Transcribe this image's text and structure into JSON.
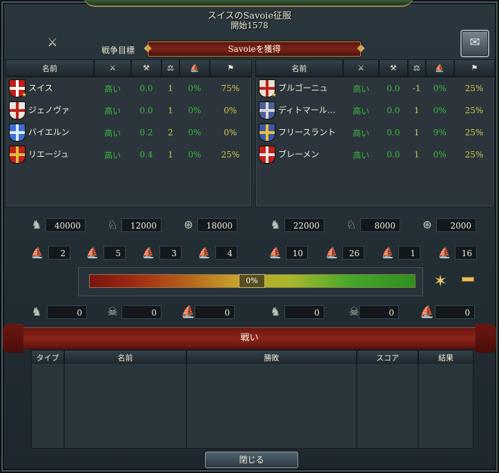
{
  "window": {
    "title": "スイスのSavoie征服",
    "subtitle": "開始1578"
  },
  "wargoal": {
    "label": "戦争目標",
    "value": "Savoieを獲得"
  },
  "columns": {
    "name": "名前",
    "icons": [
      "crossed-swords-icon",
      "crossed-axes-icon",
      "scales-icon",
      "ship-icon",
      "soldier-icon"
    ],
    "icon_glyphs": [
      "⚔",
      "⚒",
      "⚖",
      "⛵",
      "⚑"
    ]
  },
  "attackers": [
    {
      "name": "スイス",
      "enthusiasm": "高い",
      "v1": "0.0",
      "v2": "1",
      "v3": "0%",
      "v4": "75%",
      "flag_color": "#c0201a",
      "flag_cross": "#ffffff",
      "leader": true
    },
    {
      "name": "ジェノヴァ",
      "enthusiasm": "高い",
      "v1": "0.0",
      "v2": "1",
      "v3": "0%",
      "v4": "0%",
      "flag_color": "#e9e6e0",
      "flag_cross": "#c0201a",
      "leader": false
    },
    {
      "name": "バイエルン",
      "enthusiasm": "高い",
      "v1": "0.2",
      "v2": "2",
      "v3": "0%",
      "v4": "0%",
      "flag_color": "#3b6fcf",
      "flag_cross": "#dfe8f5",
      "leader": false
    },
    {
      "name": "リエージュ",
      "enthusiasm": "高い",
      "v1": "0.4",
      "v2": "1",
      "v3": "0%",
      "v4": "25%",
      "flag_color": "#c0201a",
      "flag_cross": "#e0c040",
      "leader": false
    }
  ],
  "defenders": [
    {
      "name": "ブルゴーニュ",
      "enthusiasm": "高い",
      "v1": "0.0",
      "v2": "-1",
      "v3": "0%",
      "v4": "25%",
      "flag_color": "#e8e2d6",
      "flag_cross": "#c0201a",
      "leader": true
    },
    {
      "name": "ディトマール…",
      "enthusiasm": "高い",
      "v1": "0.0",
      "v2": "1",
      "v3": "0%",
      "v4": "25%",
      "flag_color": "#4a5f9a",
      "flag_cross": "#d8d8d8",
      "leader": false
    },
    {
      "name": "フリースラント",
      "enthusiasm": "高い",
      "v1": "0.0",
      "v2": "1",
      "v3": "9%",
      "v4": "25%",
      "flag_color": "#3e56a8",
      "flag_cross": "#e6c23a",
      "leader": false
    },
    {
      "name": "ブレーメン",
      "enthusiasm": "高い",
      "v1": "0.0",
      "v2": "1",
      "v3": "0%",
      "v4": "25%",
      "flag_color": "#c0201a",
      "flag_cross": "#e8e8e8",
      "leader": false
    }
  ],
  "attacker_forces": {
    "infantry": "40000",
    "cavalry": "12000",
    "artillery": "18000",
    "heavy_ships": "2",
    "light_ships": "5",
    "galleys": "3",
    "transports": "4",
    "infantry_losses": "0",
    "attrition_losses": "0",
    "ship_losses": "0"
  },
  "defender_forces": {
    "infantry": "22000",
    "cavalry": "8000",
    "artillery": "2000",
    "heavy_ships": "10",
    "light_ships": "26",
    "galleys": "1",
    "transports": "16",
    "infantry_losses": "0",
    "attrition_losses": "0",
    "ship_losses": "0"
  },
  "warscore": {
    "percent_label": "0%",
    "value": 0
  },
  "battles": {
    "title": "戦い",
    "headers": [
      "タイプ",
      "名前",
      "勝敗",
      "スコア",
      "結果"
    ]
  },
  "close_label": "閉じる",
  "colors": {
    "ratio_green": "#3fb940",
    "gold": "#d8c84a",
    "banner_red": "#8d2519"
  }
}
